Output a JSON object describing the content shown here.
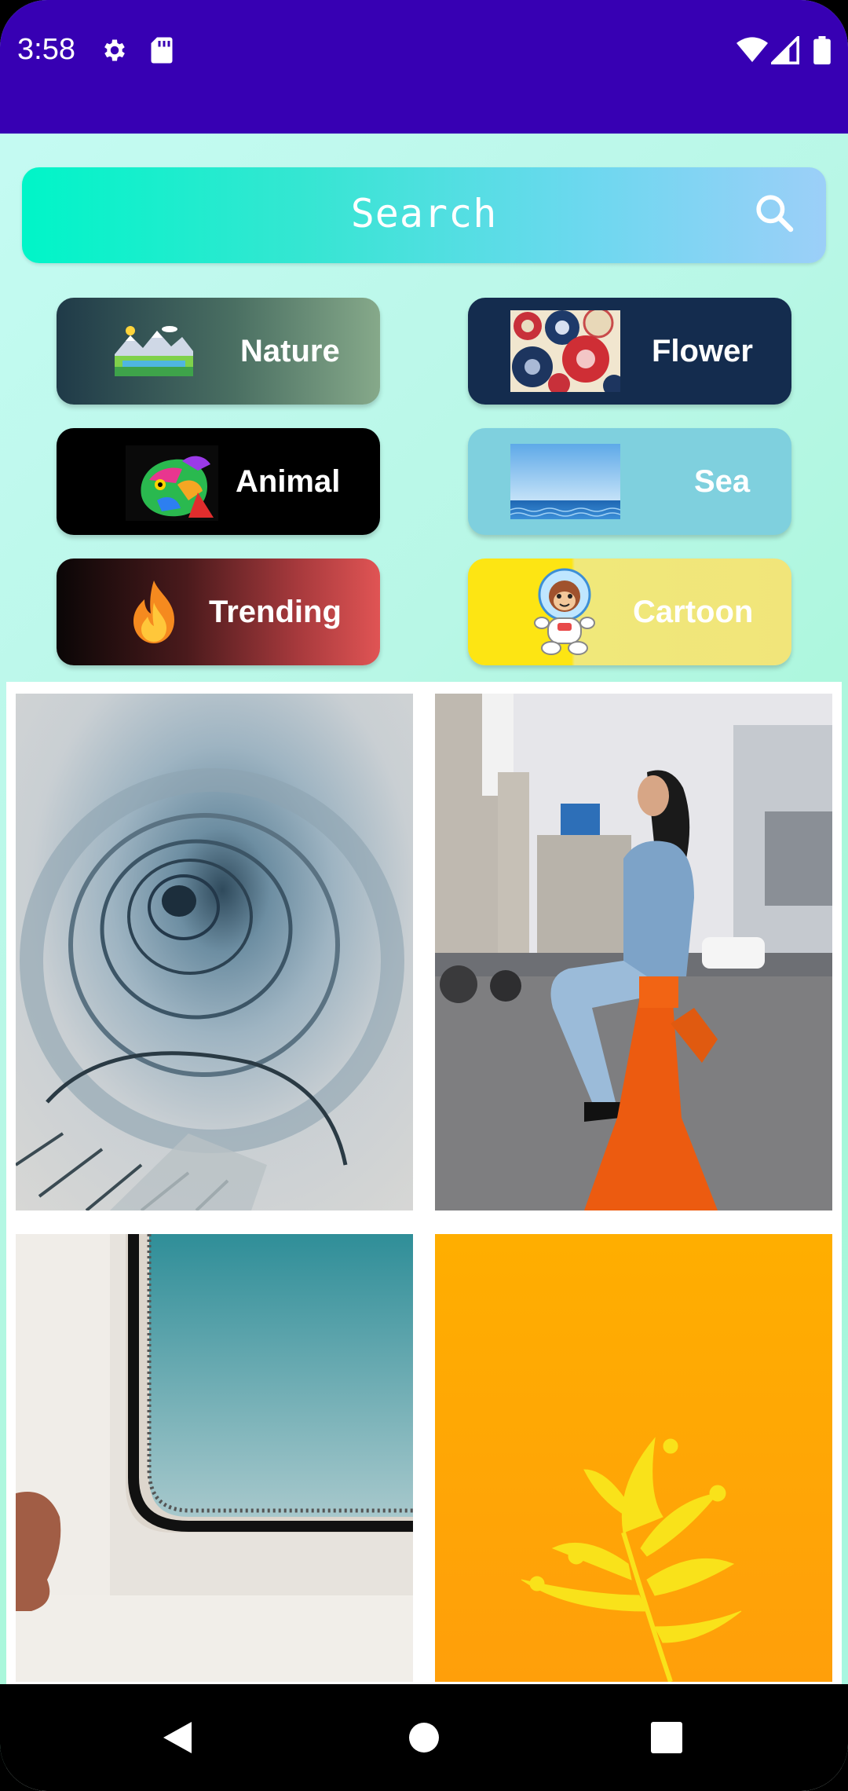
{
  "status_bar": {
    "time": "3:58",
    "icons": [
      "settings-icon",
      "sd-card-icon",
      "wifi-icon",
      "signal-icon",
      "battery-icon"
    ],
    "color": "#3700b3"
  },
  "search": {
    "label": "Search",
    "icon": "search-icon"
  },
  "categories": [
    {
      "label": "Nature",
      "icon": "landscape-thumbnail"
    },
    {
      "label": "Flower",
      "icon": "flower-pattern-thumbnail"
    },
    {
      "label": "Animal",
      "icon": "iguana-thumbnail"
    },
    {
      "label": "Sea",
      "icon": "sea-horizon-thumbnail"
    },
    {
      "label": "Trending",
      "icon": "fire-icon"
    },
    {
      "label": "Cartoon",
      "icon": "astronaut-monkey-thumbnail"
    }
  ],
  "photos": [
    {
      "name": "spiral-staircase-photo"
    },
    {
      "name": "woman-sitting-street-photo"
    },
    {
      "name": "window-frame-photo"
    },
    {
      "name": "yellow-leaf-photo"
    }
  ],
  "nav_bar": {
    "icons": [
      "back-icon",
      "home-icon",
      "recents-icon"
    ]
  }
}
